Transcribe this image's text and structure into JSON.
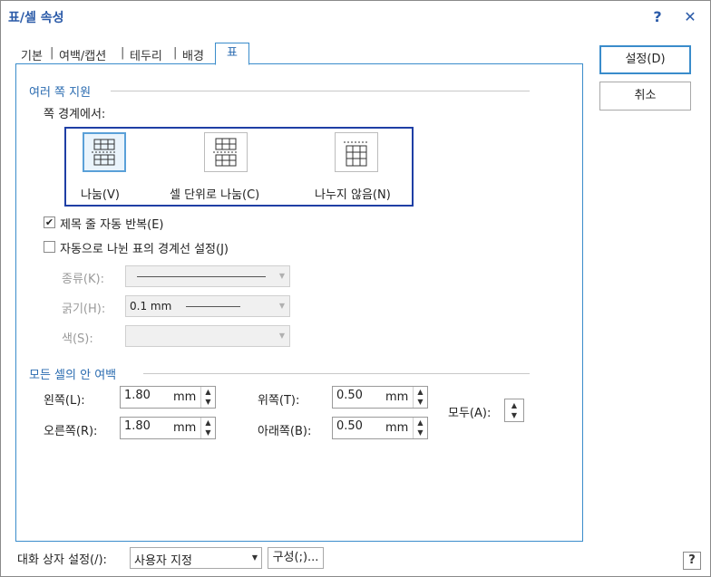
{
  "window": {
    "title": "표/셀 속성",
    "help_glyph": "?",
    "close_glyph": "✕",
    "corner_help_glyph": "?"
  },
  "tabs": [
    {
      "label": "기본"
    },
    {
      "label": "여백/캡션"
    },
    {
      "label": "테두리"
    },
    {
      "label": "배경"
    },
    {
      "label": "표",
      "active": true
    }
  ],
  "tab_separator": "|",
  "multi_page": {
    "section_title": "여러 쪽 지원",
    "boundary_label": "쪽 경계에서:",
    "options": [
      {
        "label": "나눔(V)",
        "selected": true
      },
      {
        "label": "셀 단위로 나눔(C)",
        "selected": false
      },
      {
        "label": "나누지 않음(N)",
        "selected": false
      }
    ],
    "repeat_header": {
      "label": "제목 줄 자동 반복(E)",
      "checked": true,
      "check_glyph": "✔"
    },
    "auto_border": {
      "label": "자동으로 나뉜 표의 경계선 설정(J)",
      "checked": false
    },
    "kind_label": "종류(K):",
    "thickness_label": "굵기(H):",
    "thickness_value": "0.1 mm",
    "color_label": "색(S):",
    "arrow_glyph": "▼"
  },
  "cell_margins": {
    "section_title": "모든 셀의 안 여백",
    "left": {
      "label": "왼쪽(L):",
      "value": "1.80",
      "unit": "mm"
    },
    "right": {
      "label": "오른쪽(R):",
      "value": "1.80",
      "unit": "mm"
    },
    "top": {
      "label": "위쪽(T):",
      "value": "0.50",
      "unit": "mm"
    },
    "bottom": {
      "label": "아래쪽(B):",
      "value": "0.50",
      "unit": "mm"
    },
    "all_label": "모두(A):",
    "up_glyph": "▲",
    "down_glyph": "▼"
  },
  "buttons": {
    "ok": "설정(D)",
    "cancel": "취소"
  },
  "footer": {
    "label": "대화 상자 설정(/):",
    "combo_value": "사용자 지정",
    "combo_arrow": "▼",
    "config_button": "구성(;)..."
  },
  "colors": {
    "accent": "#2a6bb0",
    "highlight_border": "#1f3fa5",
    "panel_border": "#3a8ccb"
  }
}
